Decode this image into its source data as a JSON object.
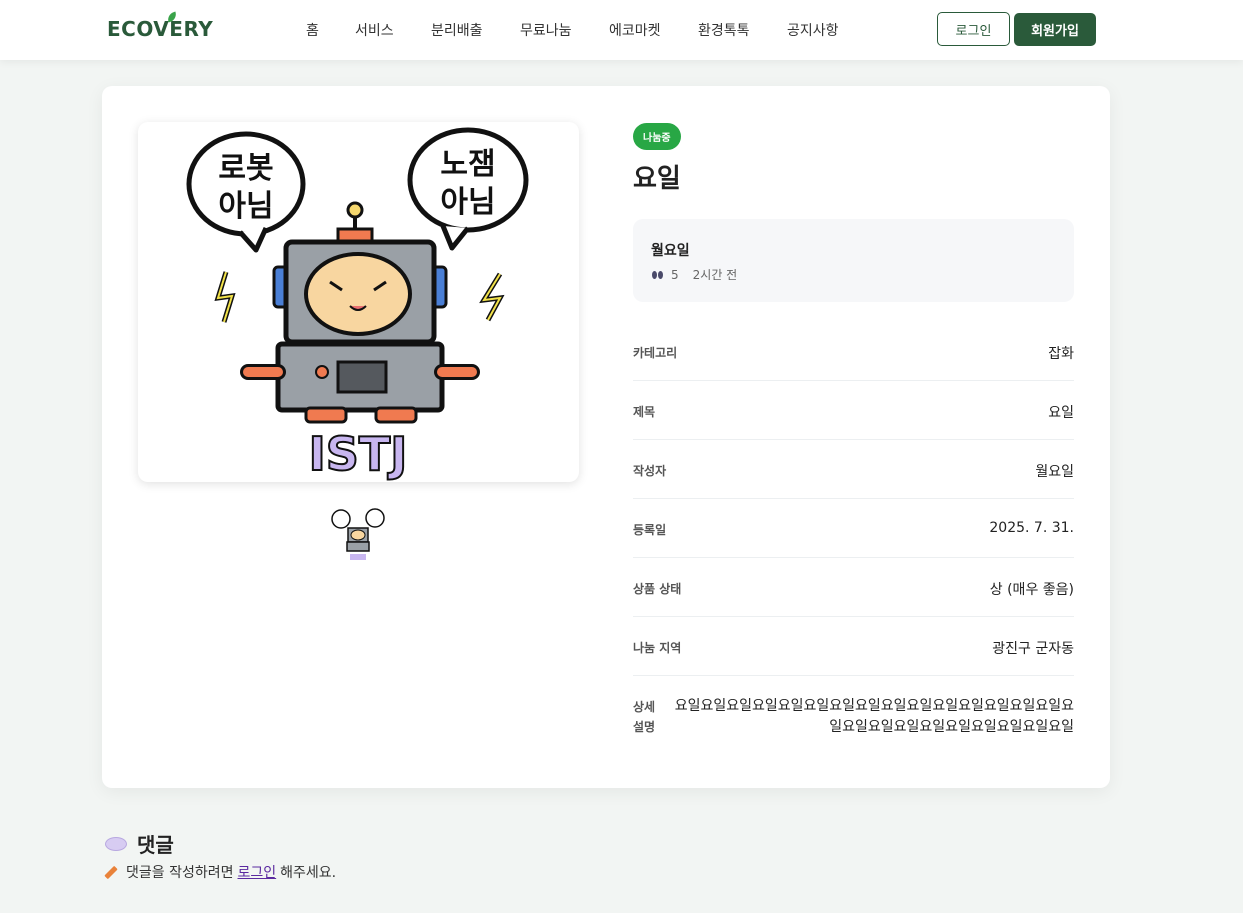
{
  "header": {
    "logo": "ECOVERY",
    "nav": [
      "홈",
      "서비스",
      "분리배출",
      "무료나눔",
      "에코마켓",
      "환경톡톡",
      "공지사항"
    ],
    "login_label": "로그인",
    "join_label": "회원가입"
  },
  "colors": {
    "brand": "#2a5a3a",
    "badge": "#28a745",
    "page_bg": "#f2f5f3"
  },
  "product": {
    "status_badge": "나눔중",
    "title": "요일",
    "image_text": {
      "bubble_left_line1": "로봇",
      "bubble_left_line2": "아님",
      "bubble_right_line1": "노잼",
      "bubble_right_line2": "아님",
      "caption": "ISTJ"
    },
    "author": {
      "name": "월요일",
      "views": "5",
      "time_ago": "2시간 전",
      "views_icon": "eyes-icon"
    },
    "info": [
      {
        "label": "카테고리",
        "value": "잡화"
      },
      {
        "label": "제목",
        "value": "요일"
      },
      {
        "label": "작성자",
        "value": "월요일"
      },
      {
        "label": "등록일",
        "value": "2025. 7. 31."
      },
      {
        "label": "상품 상태",
        "value": "상 (매우 좋음)"
      },
      {
        "label": "나눔 지역",
        "value": "광진구 군자동"
      }
    ],
    "description_label": "상세 설명",
    "description": "요일요일요일요일요일요일요일요일요일요일요일요일요일요일요일요일요일요일요일요일요일요일요일요일요일"
  },
  "comments": {
    "title": "댓글",
    "icon": "speech-bubble-icon",
    "note_prefix": "댓글을 작성하려면",
    "note_link": "로그인",
    "note_suffix": "해주세요.",
    "note_icon": "pencil-icon"
  }
}
